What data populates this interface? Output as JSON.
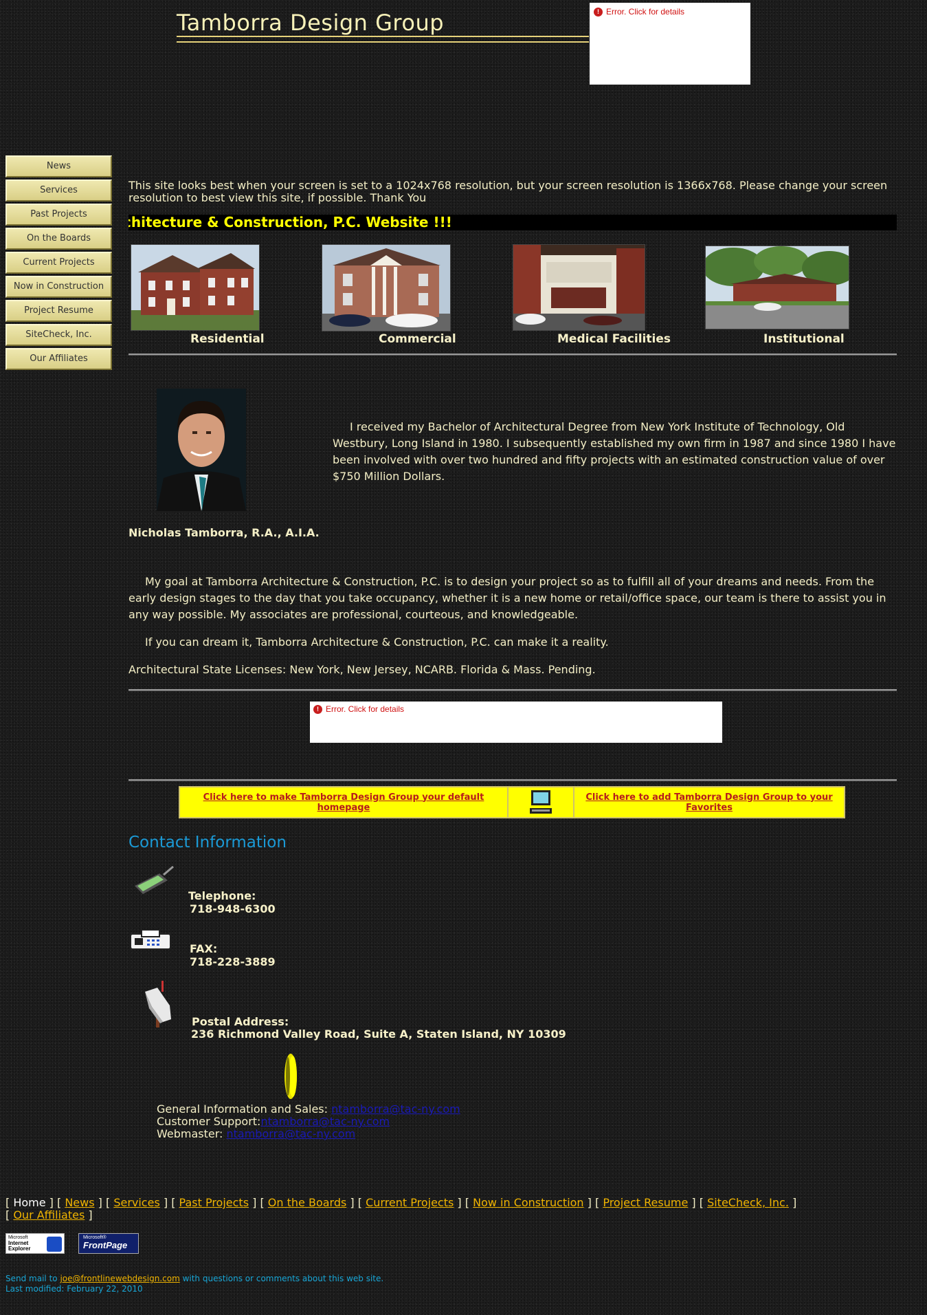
{
  "banner": {
    "title": "Tamborra Design Group"
  },
  "error_box": {
    "text": "Error. Click for details"
  },
  "nav": {
    "items": [
      "News",
      "Services",
      "Past Projects",
      "On the Boards",
      "Current Projects",
      "Now in Construction",
      "Project Resume",
      "SiteCheck, Inc.",
      "Our Affiliates"
    ]
  },
  "resolution_message": "This site looks best when your screen is set to a 1024x768 resolution, but your screen resolution is 1366x768. Please change your screen resolution to best view this site, if possible. Thank You",
  "marquee": {
    "text": "chitecture & Construction, P.C. Website !!!"
  },
  "categories": [
    {
      "label": "Residential"
    },
    {
      "label": "Commercial"
    },
    {
      "label": "Medical Facilities"
    },
    {
      "label": "Institutional"
    }
  ],
  "bio": {
    "paragraph": "I received my Bachelor of Architectural Degree from New York Institute of Technology, Old Westbury, Long Island in 1980.  I subsequently established my own firm in 1987 and since 1980 I have been involved with over two hundred and fifty projects with an estimated construction value of over $750 Million Dollars.",
    "name": "Nicholas Tamborra, R.A., A.I.A.",
    "goal": "My goal at Tamborra Architecture & Construction, P.C. is to design your project so as to fulfill all of your dreams and needs.  From the early design stages to the day that you take occupancy, whether it is a new home or retail/office space, our team is there to assist you in any way possible.  My associates are professional, courteous, and knowledgeable.",
    "dream": "If you can dream it, Tamborra Architecture & Construction, P.C. can make it a reality.",
    "licenses": "Architectural State Licenses:  New York, New Jersey, NCARB.  Florida & Mass. Pending."
  },
  "favorites": {
    "homepage_link": "Click here to make Tamborra Design Group  your default homepage",
    "favorites_link": "Click here to add Tamborra Design Group to your Favorites"
  },
  "contact": {
    "heading": "Contact Information",
    "telephone_label": "Telephone:",
    "telephone": "718-948-6300",
    "fax_label": "FAX:",
    "fax": "718-228-3889",
    "postal_label": "Postal Address:",
    "postal": "236 Richmond Valley Road, Suite A, Staten Island, NY 10309",
    "general_label": "General Information and Sales: ",
    "general_email": "ntamborra@tac-ny.com",
    "support_label": "Customer Support:",
    "support_email": "ntamborra@tac-ny.com",
    "webmaster_label": "Webmaster: ",
    "webmaster_email": "ntamborra@tac-ny.com"
  },
  "footer": {
    "home": "Home",
    "links": [
      "News",
      "Services",
      "Past Projects",
      "On the Boards",
      "Current Projects",
      "Now in Construction",
      "Project Resume",
      "SiteCheck, Inc.",
      "Our Affiliates"
    ],
    "badge_ie_top": "Microsoft",
    "badge_ie": "Internet Explorer",
    "badge_fp_top": "Microsoft®",
    "badge_fp": "FrontPage",
    "mail_prefix": "Send mail to ",
    "mail_address": "joe@frontlinewebdesign.com",
    "mail_suffix": " with questions or comments about this web site.",
    "last_modified": "Last modified: February 22, 2010"
  },
  "colors": {
    "accent_yellow": "#ffff00",
    "link_gold": "#f0b400",
    "heading_blue": "#1b9ad6",
    "error_red": "#d01010"
  }
}
